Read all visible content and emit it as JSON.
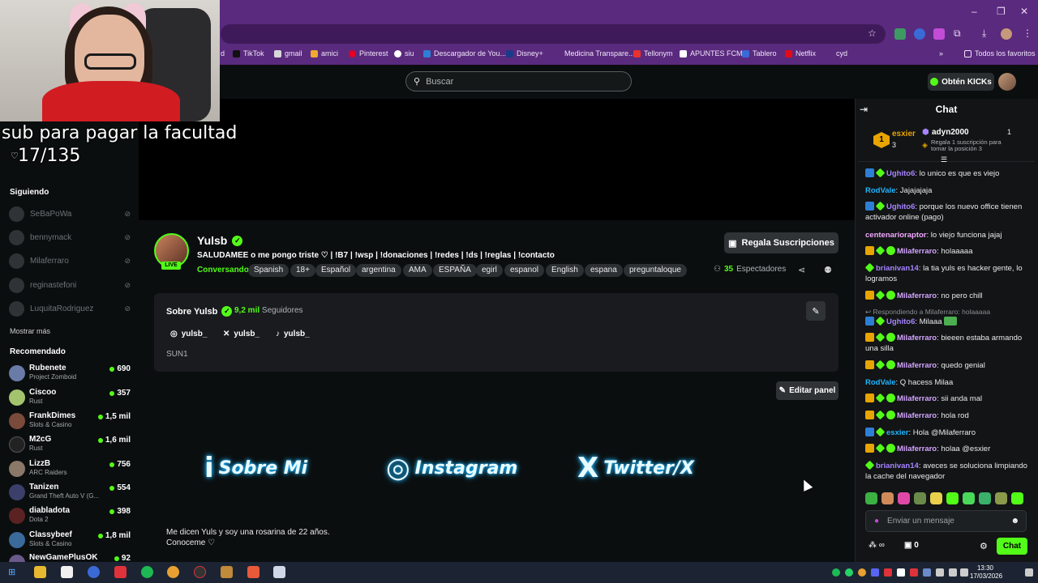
{
  "browser": {
    "bookmarks": [
      {
        "label": "d",
        "icon": "bookmark-icon"
      },
      {
        "label": "TikTok",
        "icon": "tiktok-icon"
      },
      {
        "label": "gmail",
        "icon": "gmail-icon"
      },
      {
        "label": "amici",
        "icon": "amici-icon"
      },
      {
        "label": "Pinterest",
        "icon": "pinterest-icon"
      },
      {
        "label": "siu",
        "icon": "siu-icon"
      },
      {
        "label": "Descargador de You...",
        "icon": "downloader-icon"
      },
      {
        "label": "Disney+",
        "icon": "disney-icon"
      },
      {
        "label": "Medicina Transpare...",
        "icon": "medicina-icon"
      },
      {
        "label": "Tellonym",
        "icon": "tellonym-icon"
      },
      {
        "label": "APUNTES FCM",
        "icon": "notion-icon"
      },
      {
        "label": "Tablero",
        "icon": "tablero-icon"
      },
      {
        "label": "Netflix",
        "icon": "netflix-icon"
      },
      {
        "label": "cyd",
        "icon": "cyd-icon"
      }
    ],
    "all_favorites": "Todos los favoritos",
    "more_bookmarks": "»"
  },
  "overlay": {
    "goal_text": "sub para pagar la facultad",
    "goal_count": "17/135",
    "behind_text": "♡"
  },
  "header": {
    "search_placeholder": "Buscar",
    "kicks_button": "Obtén KICKs"
  },
  "sidebar": {
    "following_title": "Siguiendo",
    "following": [
      {
        "name": "SeBaPoWa"
      },
      {
        "name": "bennymack"
      },
      {
        "name": "Milaferraro"
      },
      {
        "name": "reginastefoni"
      },
      {
        "name": "LuquitaRodriguez"
      }
    ],
    "show_more": "Mostrar más",
    "recommended_title": "Recomendado",
    "recommended": [
      {
        "name": "Rubenete",
        "game": "Project Zomboid",
        "viewers": "690",
        "avatar_color": "#6a7ba8"
      },
      {
        "name": "Ciscoo",
        "game": "Rust",
        "viewers": "357",
        "avatar_color": "#a3c46d"
      },
      {
        "name": "FrankDimes",
        "game": "Slots & Casino",
        "viewers": "1,5 mil",
        "avatar_color": "#7a4a3a"
      },
      {
        "name": "M2cG",
        "game": "Rust",
        "viewers": "1,6 mil",
        "avatar_color": "#222222"
      },
      {
        "name": "LizzB",
        "game": "ARC Raiders",
        "viewers": "756",
        "avatar_color": "#8a7868"
      },
      {
        "name": "Tanizen",
        "game": "Grand Theft Auto V (G...",
        "viewers": "554",
        "avatar_color": "#3b3f6a"
      },
      {
        "name": "diabladota",
        "game": "Dota 2",
        "viewers": "398",
        "avatar_color": "#5a2222"
      },
      {
        "name": "Classybeef",
        "game": "Slots & Casino",
        "viewers": "1,8 mil",
        "avatar_color": "#3a6a9a"
      },
      {
        "name": "NewGamePlusOK",
        "game": "",
        "viewers": "92",
        "avatar_color": "#6a5a8a"
      }
    ]
  },
  "channel": {
    "name": "Yulsb",
    "live_label": "LIVE",
    "title": "SALUDAMEE o me pongo triste ♡ | !B7 | !wsp | !donaciones | !redes | !ds | !reglas | !contacto",
    "category": "Conversando",
    "tags": [
      "Spanish",
      "18+",
      "Español",
      "argentina",
      "AMA",
      "ESPAÑA",
      "egirl",
      "espanol",
      "English",
      "espana",
      "preguntaloque"
    ],
    "gift_button": "Regala Suscripciones",
    "viewers_count": "35",
    "viewers_label": "Espectadores"
  },
  "about": {
    "title": "Sobre Yulsb",
    "followers_count": "9,2 mil",
    "followers_label": "Seguidores",
    "socials": [
      {
        "icon": "instagram-icon",
        "label": "yulsb_"
      },
      {
        "icon": "x-icon",
        "label": "yulsb_"
      },
      {
        "icon": "tiktok-icon",
        "label": "yulsb_"
      }
    ],
    "bio_short": "SUN1",
    "edit_panel": "Editar panel",
    "panels": [
      {
        "symbol": "i",
        "word": "Sobre Mi"
      },
      {
        "symbol": "◎",
        "word": "Instagram"
      },
      {
        "symbol": "X",
        "word": "Twitter/X"
      }
    ],
    "bio_line1": "Me dicen Yuls y soy una rosarina de 22 años.",
    "bio_line2": "Conoceme ♡"
  },
  "chat": {
    "title": "Chat",
    "leaderboard": {
      "first_user": "esxier",
      "first_count": "3",
      "second_user": "adyn2000",
      "second_count": "1",
      "gift_prompt": "Regala 1 suscripción para tomar la posición 3"
    },
    "messages": [
      {
        "user": "Ughito6",
        "color": "#a684ff",
        "badges": [
          "blue",
          "diamond"
        ],
        "text": "lo unico es que es viejo"
      },
      {
        "user": "RodVale",
        "color": "#1fb6ff",
        "badges": [],
        "text": "Jajajajaja"
      },
      {
        "user": "Ughito6",
        "color": "#a684ff",
        "badges": [
          "blue",
          "diamond"
        ],
        "text": "porque los nuevo office tienen activador online (pago)"
      },
      {
        "user": "centenarioraptor",
        "color": "#f4a8ff",
        "badges": [],
        "text": "lo viejo funciona jajaj"
      },
      {
        "user": "Milaferraro",
        "color": "#d4a6ff",
        "badges": [
          "gold",
          "diamond",
          "green"
        ],
        "text": "holaaaaa"
      },
      {
        "user": "brianivan14",
        "color": "#a684ff",
        "badges": [
          "diamond"
        ],
        "text": "la tia yuls es hacker gente, lo logramos"
      },
      {
        "user": "Milaferraro",
        "color": "#d4a6ff",
        "badges": [
          "gold",
          "diamond",
          "green"
        ],
        "text": "no pero chill"
      },
      {
        "user": "Ughito6",
        "color": "#a684ff",
        "badges": [
          "blue",
          "diamond"
        ],
        "text": "Milaaa"
      },
      {
        "user": "Milaferraro",
        "color": "#d4a6ff",
        "badges": [
          "gold",
          "diamond",
          "green"
        ],
        "text": "bieeen estaba armando una silla"
      },
      {
        "user": "Milaferraro",
        "color": "#d4a6ff",
        "badges": [
          "gold",
          "diamond",
          "green"
        ],
        "text": "quedo genial"
      },
      {
        "user": "RodVale",
        "color": "#1fb6ff",
        "badges": [],
        "text": "Q hacess Milaa"
      },
      {
        "user": "Milaferraro",
        "color": "#d4a6ff",
        "badges": [
          "gold",
          "diamond",
          "green"
        ],
        "text": "sii anda mal"
      },
      {
        "user": "Milaferraro",
        "color": "#d4a6ff",
        "badges": [
          "gold",
          "diamond",
          "green"
        ],
        "text": "hola rod"
      },
      {
        "user": "esxier",
        "color": "#1fb6ff",
        "badges": [
          "blue",
          "diamond"
        ],
        "text": "Hola @Milaferraro"
      },
      {
        "user": "Milaferraro",
        "color": "#d4a6ff",
        "badges": [
          "gold",
          "diamond",
          "green"
        ],
        "text": "holaa @esxier"
      },
      {
        "user": "brianivan14",
        "color": "#a684ff",
        "badges": [
          "diamond"
        ],
        "text": "aveces se soluciona limpiando la cache del navegador"
      }
    ],
    "reply_line": "Respondiendo a Milaferraro: holaaaaa",
    "input_placeholder": "Enviar un mensaje",
    "infinity": "∞",
    "points": "0",
    "send_button": "Chat"
  },
  "taskbar": {
    "time": "13:30",
    "date": "17/03/2026"
  },
  "colors": {
    "brand_green": "#53fc18",
    "browser_purple": "#5a2a7e"
  }
}
